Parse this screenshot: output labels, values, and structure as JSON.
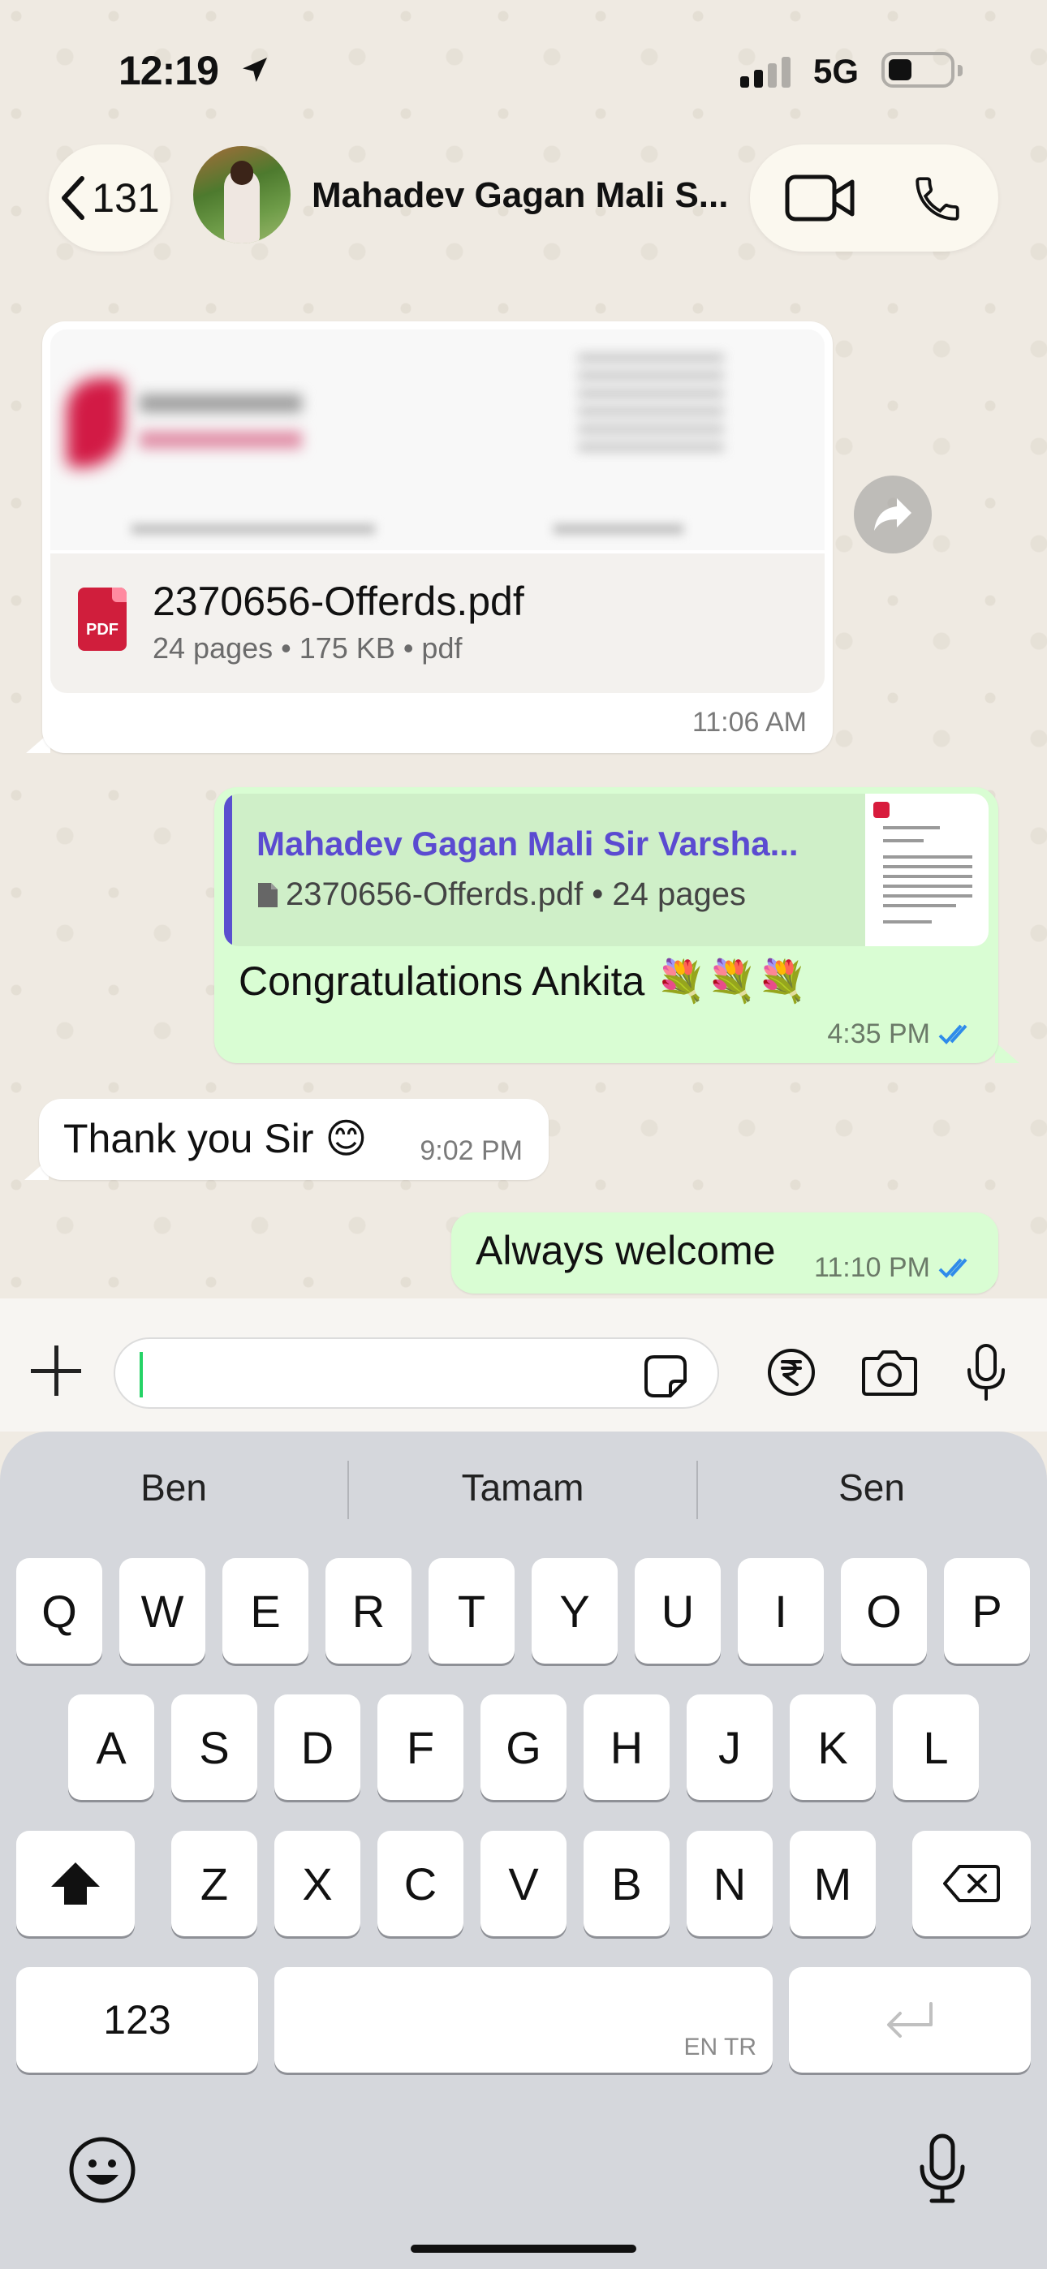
{
  "status_bar": {
    "time": "12:19",
    "network": "5G"
  },
  "header": {
    "back_count": "131",
    "contact_name": "Mahadev Gagan Mali S..."
  },
  "messages": {
    "pdf": {
      "file_name": "2370656-Offerds.pdf",
      "meta": "24 pages • 175 KB • pdf",
      "badge": "PDF",
      "time": "11:06 AM"
    },
    "reply": {
      "quote_name": "Mahadev Gagan Mali Sir Varsha...",
      "quote_doc": "2370656-Offerds.pdf • 24 pages",
      "text": "Congratulations Ankita 💐💐💐",
      "time": "4:35 PM"
    },
    "thanks": {
      "text": "Thank you Sir 😊",
      "time": "9:02 PM"
    },
    "welcome": {
      "text": "Always welcome",
      "time": "11:10 PM"
    }
  },
  "input": {
    "placeholder": ""
  },
  "keyboard": {
    "suggestions": [
      "Ben",
      "Tamam",
      "Sen"
    ],
    "row1": [
      "Q",
      "W",
      "E",
      "R",
      "T",
      "Y",
      "U",
      "I",
      "O",
      "P"
    ],
    "row2": [
      "A",
      "S",
      "D",
      "F",
      "G",
      "H",
      "J",
      "K",
      "L"
    ],
    "row3": [
      "Z",
      "X",
      "C",
      "V",
      "B",
      "N",
      "M"
    ],
    "numbers_label": "123",
    "space_lang": "EN TR"
  },
  "colors": {
    "out_bubble": "#d9fdd3",
    "in_bubble": "#ffffff",
    "quote_name": "#5b4bd1",
    "read_ticks": "#2f8bea",
    "pdf_red": "#d01e3c"
  },
  "icons": [
    "location-arrow-icon",
    "back-chevron-icon",
    "video-call-icon",
    "phone-call-icon",
    "forward-icon",
    "file-icon",
    "double-check-icon",
    "plus-icon",
    "sticker-icon",
    "rupee-icon",
    "camera-icon",
    "mic-icon",
    "shift-icon",
    "backspace-icon",
    "return-icon",
    "emoji-icon",
    "dictation-mic-icon"
  ]
}
